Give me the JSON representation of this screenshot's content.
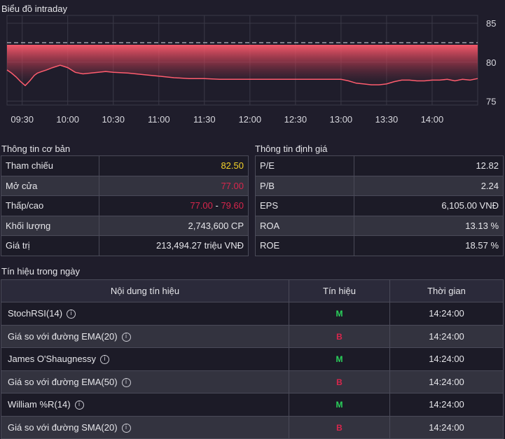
{
  "chart_data": {
    "type": "area",
    "title": "Biểu đồ intraday",
    "reference_line": 82.5,
    "ylim": [
      74.5,
      86
    ],
    "y_ticks": [
      85,
      80,
      75
    ],
    "x_tick_labels": [
      "09:30",
      "10:00",
      "10:30",
      "11:00",
      "11:30",
      "12:00",
      "12:30",
      "13:00",
      "13:30",
      "14:00"
    ],
    "x_tick_minutes": [
      570,
      600,
      630,
      660,
      690,
      720,
      750,
      780,
      810,
      840
    ],
    "x_range": [
      560,
      870
    ],
    "x": [
      560,
      563,
      566,
      569,
      572,
      575,
      578,
      580,
      583,
      586,
      590,
      595,
      600,
      605,
      610,
      615,
      620,
      625,
      630,
      640,
      650,
      660,
      670,
      680,
      690,
      700,
      710,
      720,
      730,
      740,
      750,
      760,
      770,
      780,
      785,
      790,
      795,
      800,
      805,
      810,
      815,
      820,
      825,
      830,
      835,
      840,
      845,
      850,
      855,
      860,
      865,
      870
    ],
    "values": [
      79.0,
      78.6,
      78.1,
      77.5,
      77.0,
      77.6,
      78.3,
      78.6,
      78.8,
      79.0,
      79.3,
      79.6,
      79.3,
      78.7,
      78.5,
      78.6,
      78.7,
      78.8,
      78.7,
      78.6,
      78.4,
      78.2,
      78.0,
      77.9,
      77.9,
      77.8,
      77.8,
      77.8,
      77.8,
      77.8,
      77.8,
      77.8,
      77.8,
      77.8,
      77.6,
      77.3,
      77.2,
      77.1,
      77.1,
      77.2,
      77.5,
      77.7,
      77.7,
      77.6,
      77.6,
      77.7,
      77.7,
      77.8,
      77.6,
      77.8,
      77.7,
      77.9
    ],
    "color": "#ff5c6e"
  },
  "basic_info": {
    "title": "Thông tin cơ bản",
    "rows": [
      {
        "label": "Tham chiếu",
        "value": "82.50",
        "color": "#f5d32a"
      },
      {
        "label": "Mở cửa",
        "value": "77.00",
        "color": "#d8264c"
      },
      {
        "label": "Thấp/cao",
        "low": "77.00",
        "sep": " - ",
        "high": "79.60"
      },
      {
        "label": "Khối lượng",
        "value": "2,743,600 CP",
        "color": "#e6e6ea"
      },
      {
        "label": "Giá trị",
        "value": "213,494.27 triệu VNĐ",
        "color": "#e6e6ea"
      }
    ]
  },
  "valuation": {
    "title": "Thông tin định giá",
    "rows": [
      {
        "label": "P/E",
        "value": "12.82"
      },
      {
        "label": "P/B",
        "value": "2.24"
      },
      {
        "label": "EPS",
        "value": "6,105.00 VNĐ"
      },
      {
        "label": "ROA",
        "value": "13.13 %"
      },
      {
        "label": "ROE",
        "value": "18.57 %"
      }
    ]
  },
  "signals": {
    "title": "Tín hiệu trong ngày",
    "headers": {
      "content": "Nội dung tín hiệu",
      "signal": "Tín hiệu",
      "time": "Thời gian"
    },
    "rows": [
      {
        "name": "StochRSI(14)",
        "signal": "M",
        "time": "14:24:00"
      },
      {
        "name": "Giá so với đường EMA(20)",
        "signal": "B",
        "time": "14:24:00"
      },
      {
        "name": "James O'Shaugnessy",
        "signal": "M",
        "time": "14:24:00"
      },
      {
        "name": "Giá so với đường EMA(50)",
        "signal": "B",
        "time": "14:24:00"
      },
      {
        "name": "William %R(14)",
        "signal": "M",
        "time": "14:24:00"
      },
      {
        "name": "Giá so với đường SMA(20)",
        "signal": "B",
        "time": "14:24:00"
      }
    ]
  }
}
